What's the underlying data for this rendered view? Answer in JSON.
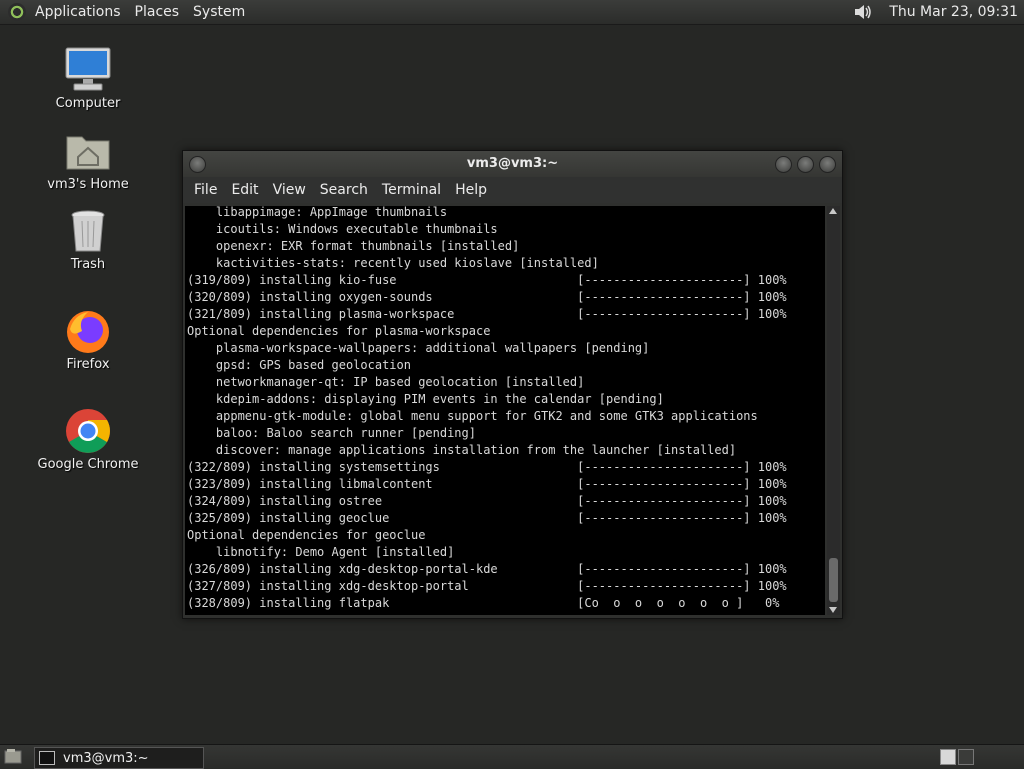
{
  "top_panel": {
    "menus": [
      "Applications",
      "Places",
      "System"
    ],
    "clock": "Thu Mar 23, 09:31"
  },
  "desktop": {
    "icons": [
      {
        "label": "Computer",
        "icon": "computer-icon"
      },
      {
        "label": "vm3's Home",
        "icon": "home-folder-icon"
      },
      {
        "label": "Trash",
        "icon": "trash-icon"
      },
      {
        "label": "Firefox",
        "icon": "firefox-icon"
      },
      {
        "label": "Google Chrome",
        "icon": "chrome-icon"
      }
    ]
  },
  "terminal": {
    "title": "vm3@vm3:~",
    "menu": [
      "File",
      "Edit",
      "View",
      "Search",
      "Terminal",
      "Help"
    ],
    "lines": [
      "    libappimage: AppImage thumbnails",
      "    icoutils: Windows executable thumbnails",
      "    openexr: EXR format thumbnails [installed]",
      "    kactivities-stats: recently used kioslave [installed]",
      "(319/809) installing kio-fuse                         [----------------------] 100%",
      "(320/809) installing oxygen-sounds                    [----------------------] 100%",
      "(321/809) installing plasma-workspace                 [----------------------] 100%",
      "Optional dependencies for plasma-workspace",
      "    plasma-workspace-wallpapers: additional wallpapers [pending]",
      "    gpsd: GPS based geolocation",
      "    networkmanager-qt: IP based geolocation [installed]",
      "    kdepim-addons: displaying PIM events in the calendar [pending]",
      "    appmenu-gtk-module: global menu support for GTK2 and some GTK3 applications",
      "    baloo: Baloo search runner [pending]",
      "    discover: manage applications installation from the launcher [installed]",
      "(322/809) installing systemsettings                   [----------------------] 100%",
      "(323/809) installing libmalcontent                    [----------------------] 100%",
      "(324/809) installing ostree                           [----------------------] 100%",
      "(325/809) installing geoclue                          [----------------------] 100%",
      "Optional dependencies for geoclue",
      "    libnotify: Demo Agent [installed]",
      "(326/809) installing xdg-desktop-portal-kde           [----------------------] 100%",
      "(327/809) installing xdg-desktop-portal               [----------------------] 100%",
      "(328/809) installing flatpak                          [Co  o  o  o  o  o  o ]   0%"
    ]
  },
  "bottom_panel": {
    "task_label": "vm3@vm3:~"
  }
}
